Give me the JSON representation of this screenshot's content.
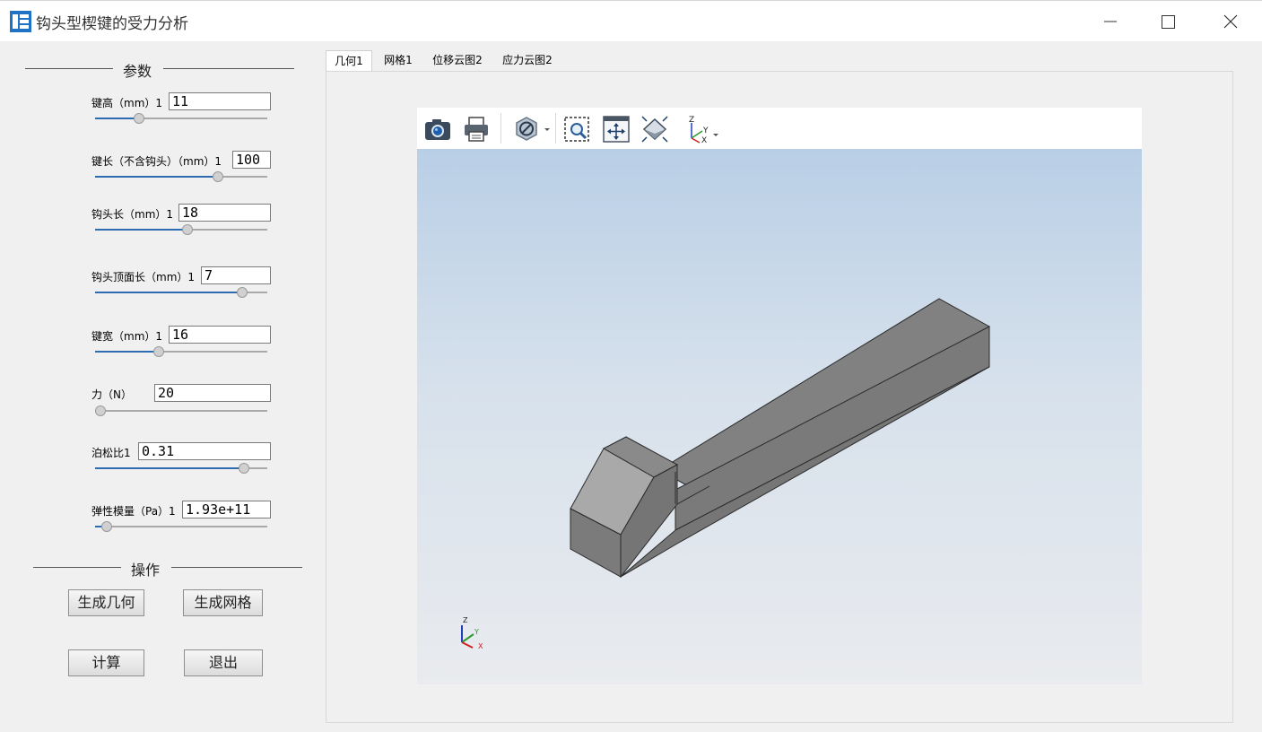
{
  "window": {
    "title": "钩头型楔键的受力分析",
    "icon": "app-icon",
    "controls": [
      "minimize-icon",
      "maximize-icon",
      "close-icon"
    ]
  },
  "params_panel": {
    "group_title": "参数",
    "params": [
      {
        "label": "键高（mm）1",
        "value": "11",
        "slider_fraction": 0.24
      },
      {
        "label": "键长（不含钩头）（mm）1",
        "value": "100",
        "slider_fraction": 0.73
      },
      {
        "label": "钩头长（mm）1",
        "value": "18",
        "slider_fraction": 0.54
      },
      {
        "label": "钩头顶面长（mm）1",
        "value": "7",
        "slider_fraction": 0.88
      },
      {
        "label": "键宽（mm）1",
        "value": "16",
        "slider_fraction": 0.36
      },
      {
        "label": "力（N）",
        "value": "20",
        "slider_fraction": 0.0
      },
      {
        "label": "泊松比1",
        "value": "0.31",
        "slider_fraction": 0.89
      },
      {
        "label": "弹性模量（Pa）1",
        "value": "1.93e+11",
        "slider_fraction": 0.04
      }
    ]
  },
  "actions_panel": {
    "group_title": "操作",
    "buttons": {
      "generate_geometry": "生成几何",
      "generate_mesh": "生成网格",
      "compute": "计算",
      "exit": "退出"
    }
  },
  "tabs": [
    {
      "label": "几何1",
      "active": true
    },
    {
      "label": "网格1",
      "active": false
    },
    {
      "label": "位移云图2",
      "active": false
    },
    {
      "label": "应力云图2",
      "active": false
    }
  ],
  "viewer": {
    "toolbar": [
      "camera-icon",
      "print-icon",
      "display-mode-icon",
      "zoom-box-icon",
      "fit-all-icon",
      "isometric-view-icon",
      "axes-orientation-icon"
    ],
    "triad_labels": {
      "z": "Z",
      "y": "Y",
      "x": "X"
    },
    "colors": {
      "model_face": "#828282",
      "model_side": "#6e6e6e",
      "model_highlight": "#a9a9a9",
      "background_top": "#b9cfe6",
      "background_bottom": "#e9ebee"
    }
  }
}
